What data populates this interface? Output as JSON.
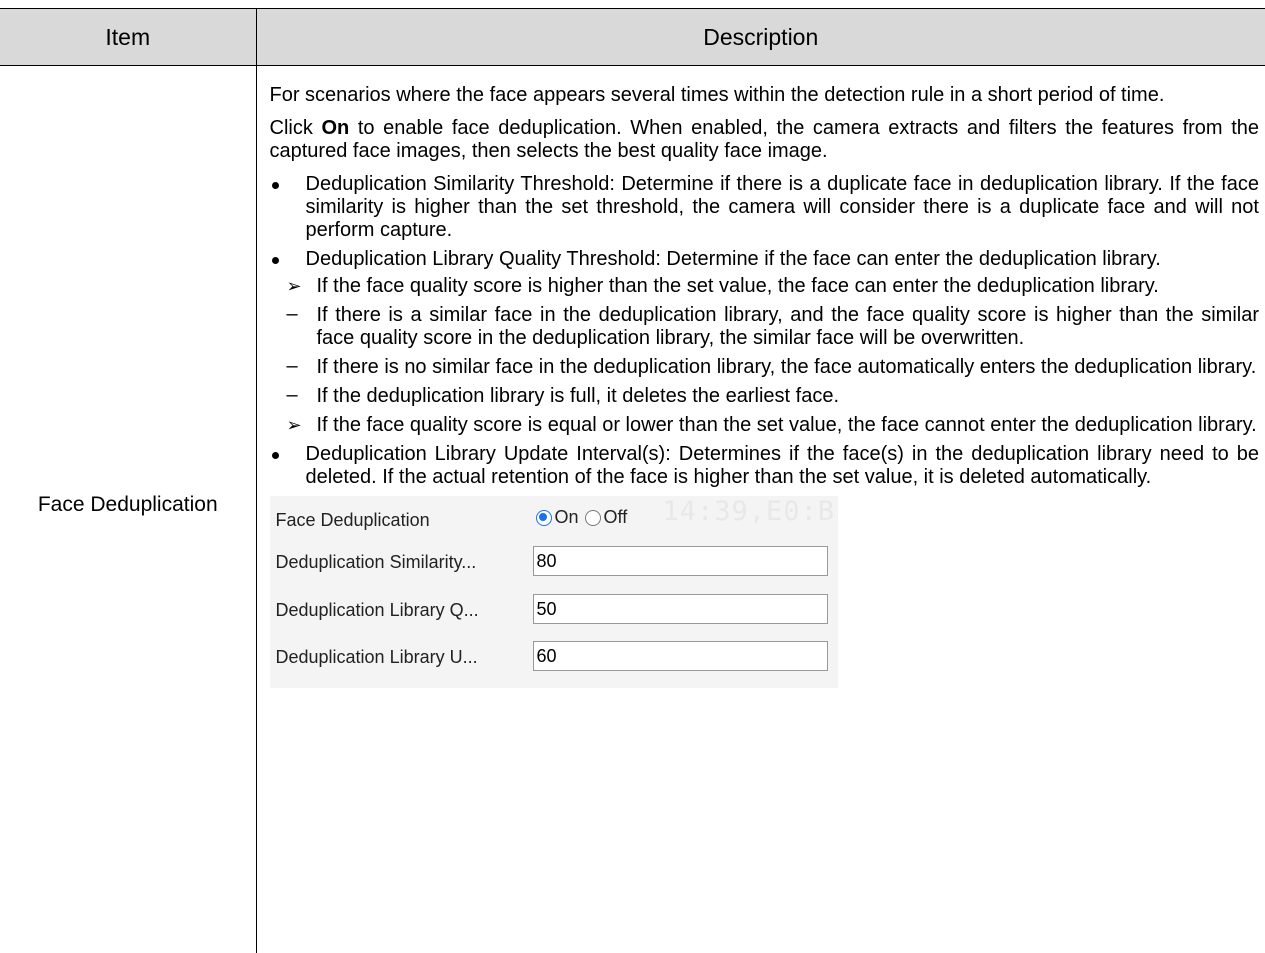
{
  "header": {
    "item": "Item",
    "description": "Description"
  },
  "row": {
    "item": "Face Deduplication",
    "intro": "For scenarios where the face appears several times within the detection rule in a short period of time.",
    "click_pre": "Click ",
    "click_bold": "On",
    "click_post": " to enable face deduplication. When enabled, the camera extracts and filters the features from the captured face images, then selects the best quality face image.",
    "bullet1": "Deduplication Similarity Threshold: Determine if there is a duplicate face in deduplication library. If the face similarity is higher than the set threshold, the camera will consider there is a duplicate face and will not perform capture.",
    "bullet2": "Deduplication Library Quality Threshold: Determine if the face can enter the deduplication library.",
    "sub1": "If the face quality score is higher than the set value, the face can enter the deduplication library.",
    "dash1": "If there is a similar face in the deduplication library, and the face quality score is higher than the similar face quality score in the deduplication library, the similar face will be overwritten.",
    "dash2": "If there is no similar face in the deduplication library, the face automatically enters the deduplication library.",
    "dash3": "If the deduplication library is full, it deletes the earliest face.",
    "sub2": "If the face quality score is equal or lower than the set value, the face cannot enter the deduplication library.",
    "bullet3": "Deduplication Library Update Interval(s): Determines if the face(s) in the deduplication library need to be deleted. If the actual retention of the face is higher than the set value, it is deleted automatically.",
    "arrow_glyph": "➢",
    "dash_glyph": "–"
  },
  "ui": {
    "watermark": "14:39,E0:B",
    "face_dedup_label": "Face Deduplication",
    "on_label": "On",
    "off_label": "Off",
    "selected": "On",
    "similarity_label": "Deduplication Similarity...",
    "similarity_value": "80",
    "quality_label": "Deduplication Library Q...",
    "quality_value": "50",
    "update_label": "Deduplication Library U...",
    "update_value": "60",
    "accent_color": "#1a73e8"
  }
}
